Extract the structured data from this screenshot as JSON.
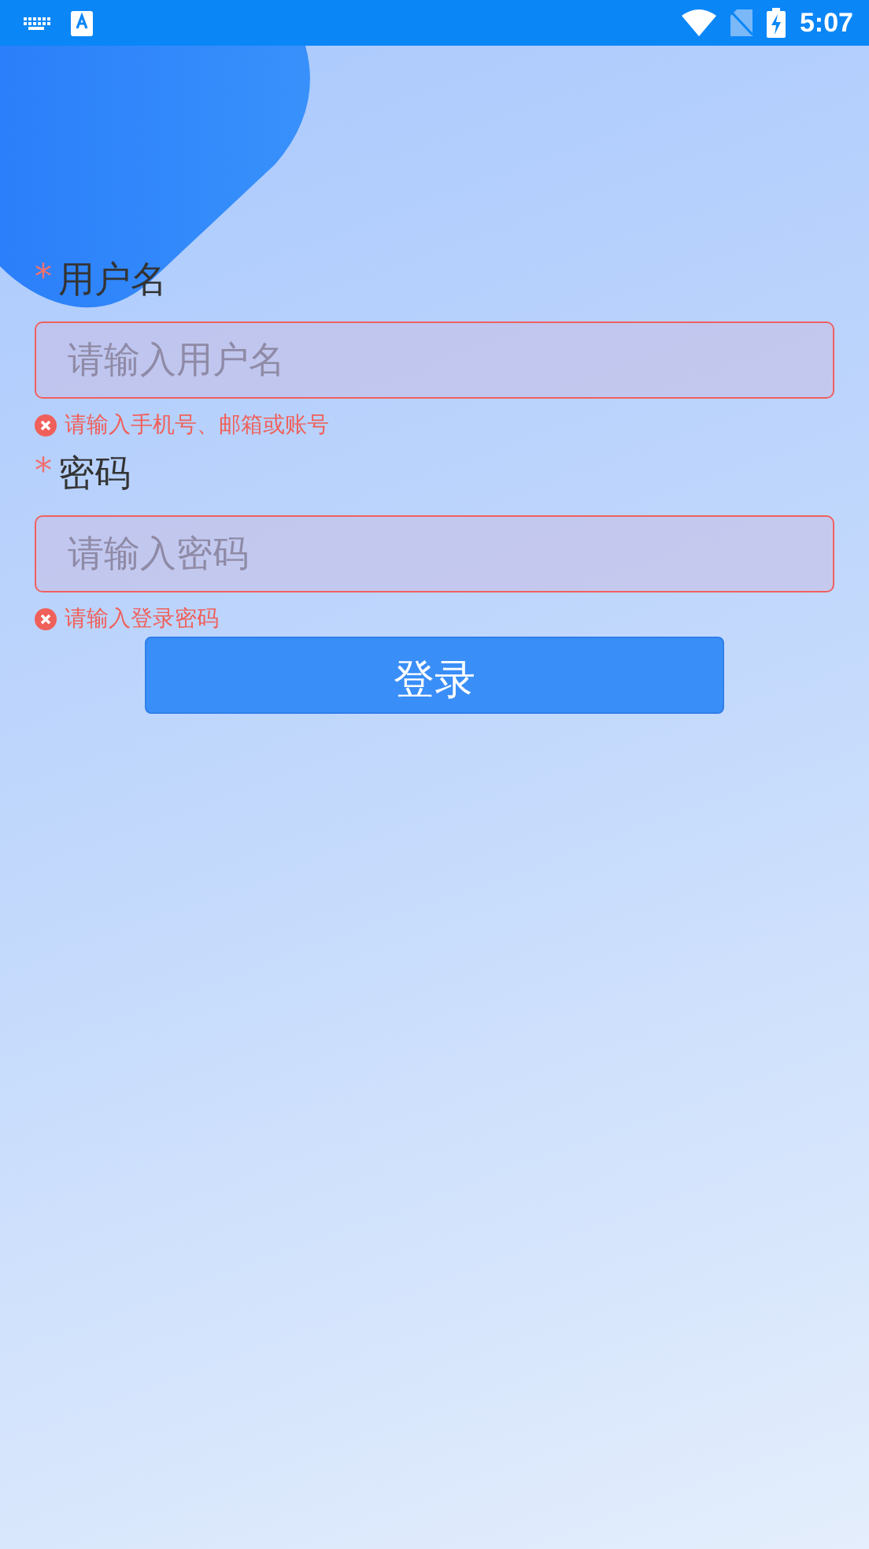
{
  "status_bar": {
    "time": "5:07"
  },
  "form": {
    "fields": [
      {
        "label": "用户名",
        "required_mark": "*",
        "placeholder": "请输入用户名",
        "error": true,
        "error_message": "请输入手机号、邮箱或账号"
      },
      {
        "label": "密码",
        "required_mark": "*",
        "placeholder": "请输入密码",
        "error": true,
        "error_message": "请输入登录密码"
      }
    ],
    "submit_button": {
      "label": "登录"
    }
  }
}
